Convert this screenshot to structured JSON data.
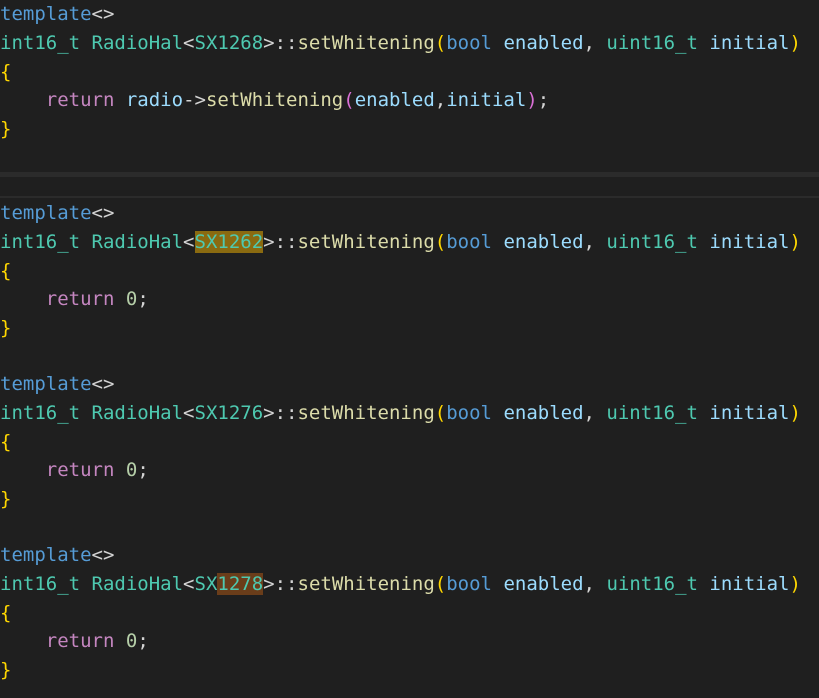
{
  "top_block": {
    "template_kw": "template",
    "template_brackets": "<>",
    "return_type": "int16_t",
    "class_name": "RadioHal",
    "angle_open": "<",
    "chip": "SX1268",
    "angle_close": ">",
    "scope": "::",
    "func": "setWhitening",
    "paren_open": "(",
    "p1_type": "bool",
    "p1_name": "enabled",
    "comma": ",",
    "p2_type": "uint16_t",
    "p2_name": "initial",
    "paren_close": ")",
    "brace_open": "{",
    "return_kw": "return",
    "target": "radio",
    "arrow": "->",
    "call_func": "setWhitening",
    "call_open": "(",
    "arg1": "enabled",
    "arg_comma": ",",
    "arg2": "initial",
    "call_close": ")",
    "semi": ";",
    "brace_close": "}"
  },
  "blocks": [
    {
      "template_kw": "template",
      "template_brackets": "<>",
      "return_type": "int16_t",
      "class_name": "RadioHal",
      "angle_open": "<",
      "chip_a": "SX1262",
      "chip_b": "",
      "angle_close": ">",
      "scope": "::",
      "func": "setWhitening",
      "paren_open": "(",
      "p1_type": "bool",
      "p1_name": "enabled",
      "comma": ",",
      "p2_type": "uint16_t",
      "p2_name": "initial",
      "paren_close": ")",
      "brace_open": "{",
      "return_kw": "return",
      "return_val": "0",
      "semi": ";",
      "brace_close": "}",
      "highlight_color": "#8a6a10"
    },
    {
      "template_kw": "template",
      "template_brackets": "<>",
      "return_type": "int16_t",
      "class_name": "RadioHal",
      "angle_open": "<",
      "chip_a": "SX1276",
      "chip_b": "",
      "angle_close": ">",
      "scope": "::",
      "func": "setWhitening",
      "paren_open": "(",
      "p1_type": "bool",
      "p1_name": "enabled",
      "comma": ",",
      "p2_type": "uint16_t",
      "p2_name": "initial",
      "paren_close": ")",
      "brace_open": "{",
      "return_kw": "return",
      "return_val": "0",
      "semi": ";",
      "brace_close": "}"
    },
    {
      "template_kw": "template",
      "template_brackets": "<>",
      "return_type": "int16_t",
      "class_name": "RadioHal",
      "angle_open": "<",
      "chip_a": "SX",
      "chip_b": "1278",
      "angle_close": ">",
      "scope": "::",
      "func": "setWhitening",
      "paren_open": "(",
      "p1_type": "bool",
      "p1_name": "enabled",
      "comma": ",",
      "p2_type": "uint16_t",
      "p2_name": "initial",
      "paren_close": ")",
      "brace_open": "{",
      "return_kw": "return",
      "return_val": "0",
      "semi": ";",
      "brace_close": "}",
      "highlight_color": "#6a3d1a"
    }
  ],
  "colors": {
    "background": "#1f1f1f",
    "keyword": "#569cd6",
    "control_keyword": "#c586c0",
    "type": "#4ec9b0",
    "function": "#dcdcaa",
    "parameter": "#9cdcfe",
    "number": "#b5cea8",
    "bracket_level1": "#ffd700",
    "bracket_level2": "#da70d6"
  }
}
